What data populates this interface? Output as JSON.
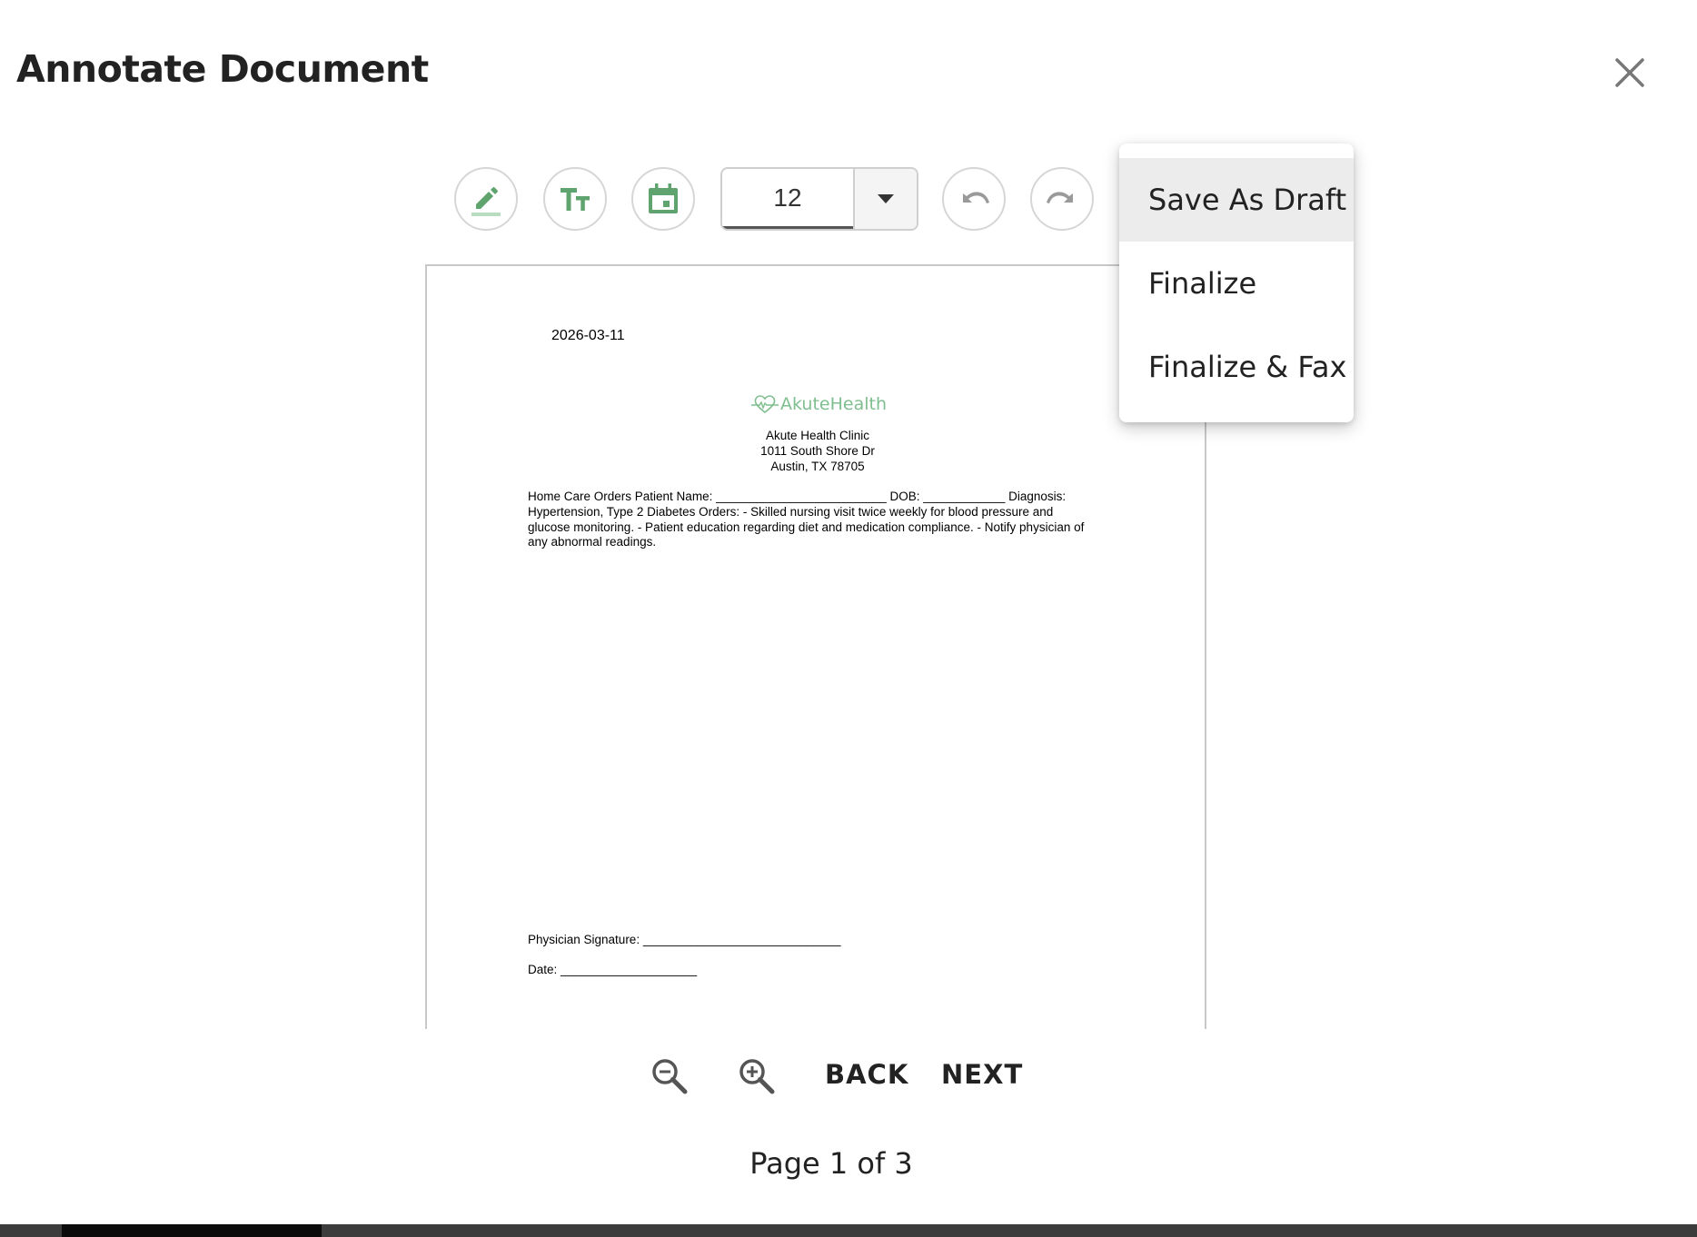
{
  "dialog": {
    "title": "Annotate Document",
    "close_icon": "close-icon"
  },
  "toolbar": {
    "tools": [
      {
        "name": "draw-tool",
        "icon": "pencil-icon"
      },
      {
        "name": "text-tool",
        "icon": "text-size-icon"
      },
      {
        "name": "date-tool",
        "icon": "calendar-icon"
      }
    ],
    "font_size": "12",
    "undo_icon": "undo-icon",
    "redo_icon": "redo-icon",
    "accent_color": "#5fa36e"
  },
  "menu": {
    "items": [
      "Save As Draft",
      "Finalize",
      "Finalize & Fax"
    ],
    "highlighted": "Save As Draft"
  },
  "document": {
    "date": "2026-03-11",
    "logo_text": "AkuteHealth",
    "clinic_name": "Akute Health Clinic",
    "address_line1": "1011 South Shore Dr",
    "address_line2": "Austin, TX 78705",
    "body_line1": "Home Care Orders Patient Name: _________________________ DOB: ____________ Diagnosis:",
    "body_line2": "Hypertension, Type 2 Diabetes Orders: - Skilled nursing visit twice weekly for blood pressure and",
    "body_line3": "glucose monitoring. - Patient education regarding diet and medication compliance. - Notify physician of",
    "body_line4": "any abnormal readings.",
    "signature_line": "Physician Signature: _____________________________",
    "date_line": "Date: ____________________"
  },
  "controls": {
    "zoom_out_icon": "zoom-out-icon",
    "zoom_in_icon": "zoom-in-icon",
    "back_label": "BACK",
    "next_label": "NEXT",
    "page_indicator": "Page 1 of 3"
  }
}
